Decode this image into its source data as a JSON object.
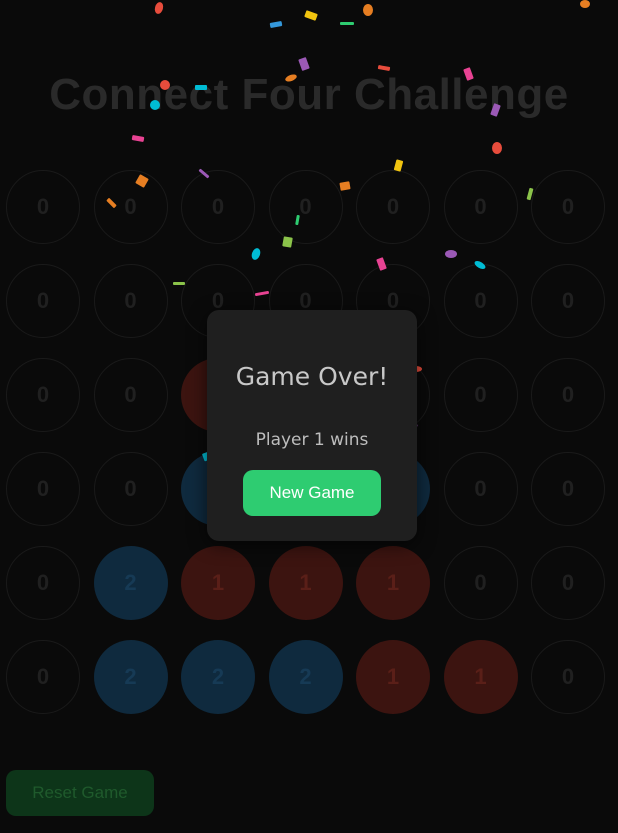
{
  "title": "Connect Four Challenge",
  "board": [
    [
      "0",
      "0",
      "0",
      "0",
      "0",
      "0",
      "0"
    ],
    [
      "0",
      "0",
      "0",
      "0",
      "0",
      "0",
      "0"
    ],
    [
      "0",
      "0",
      "1",
      "0",
      "0",
      "0",
      "0"
    ],
    [
      "0",
      "0",
      "2",
      "0",
      "2",
      "0",
      "0"
    ],
    [
      "0",
      "2",
      "1",
      "1",
      "1",
      "0",
      "0"
    ],
    [
      "0",
      "2",
      "2",
      "2",
      "1",
      "1",
      "0"
    ]
  ],
  "reset_label": "Reset Game",
  "modal": {
    "title": "Game Over!",
    "message": "Player 1 wins",
    "button_label": "New Game"
  },
  "colors": {
    "player1": "#e74c3c",
    "player2": "#3498db",
    "accent": "#2ecc71",
    "confetti": [
      "#e74c3c",
      "#3498db",
      "#2ecc71",
      "#9b59b6",
      "#f1c40f",
      "#e67e22",
      "#e84393",
      "#00bcd4",
      "#8bc34a",
      "#ff7043"
    ]
  }
}
